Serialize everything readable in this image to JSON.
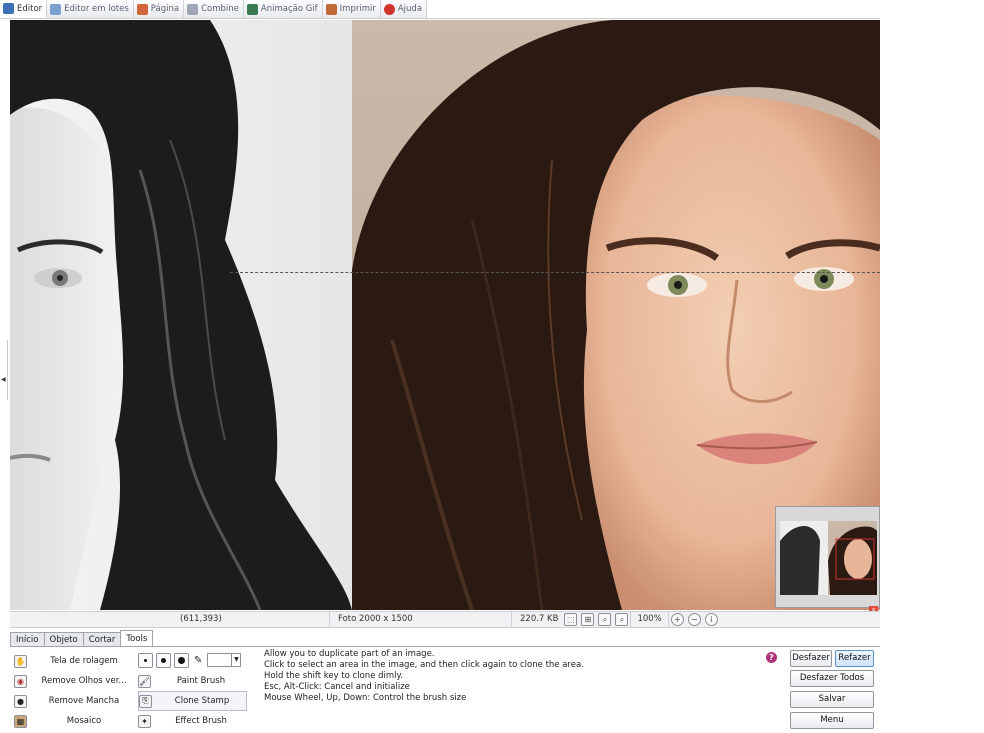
{
  "tabs": [
    {
      "label": "Editor",
      "icon": "editor-icon",
      "color": "#3b6fb6"
    },
    {
      "label": "Editor em lotes",
      "icon": "batch-editor-icon",
      "color": "#7aa0d0"
    },
    {
      "label": "Página",
      "icon": "page-icon",
      "color": "#d0663a"
    },
    {
      "label": "Combine",
      "icon": "combine-icon",
      "color": "#a0a6b8"
    },
    {
      "label": "Animação Gif",
      "icon": "gif-animation-icon",
      "color": "#3c7a54"
    },
    {
      "label": "Imprimir",
      "icon": "print-icon",
      "color": "#c06a3a"
    },
    {
      "label": "Ajuda",
      "icon": "help-icon",
      "color": "#d0342a"
    }
  ],
  "status": {
    "coords": "(611,393)",
    "photo": "Foto 2000 x 1500",
    "size": "220.7 KB",
    "zoom": "100%"
  },
  "panel_tabs": [
    "Início",
    "Objeto",
    "Cortar",
    "Tools"
  ],
  "tools_left": [
    {
      "label": "Tela de rolagem",
      "icon": "hand-icon"
    },
    {
      "label": "Remove Olhos ver...",
      "icon": "red-eye-icon"
    },
    {
      "label": "Remove Mancha",
      "icon": "blemish-icon"
    },
    {
      "label": "Mosaico",
      "icon": "mosaic-icon"
    }
  ],
  "tools_right": [
    {
      "label": "Paint Brush",
      "icon": "paint-brush-icon"
    },
    {
      "label": "Clone Stamp",
      "icon": "clone-stamp-icon"
    },
    {
      "label": "Effect Brush",
      "icon": "effect-brush-icon"
    }
  ],
  "help_lines": [
    "Allow you to duplicate part of an image.",
    "Click to select an area in the image, and then click again to clone the area.",
    "Hold the shift key to clone dimly.",
    "Esc, Alt-Click: Cancel and initialize",
    "Mouse Wheel, Up, Down: Control the brush size"
  ],
  "buttons": {
    "undo": "Desfazer",
    "redo": "Refazer",
    "undo_all": "Desfazer Todos",
    "save": "Salvar",
    "menu": "Menu"
  },
  "colors": {
    "accent_button": "#cfe3f8",
    "help_badge": "#b0327a",
    "thumb_close": "#e04a3a"
  }
}
